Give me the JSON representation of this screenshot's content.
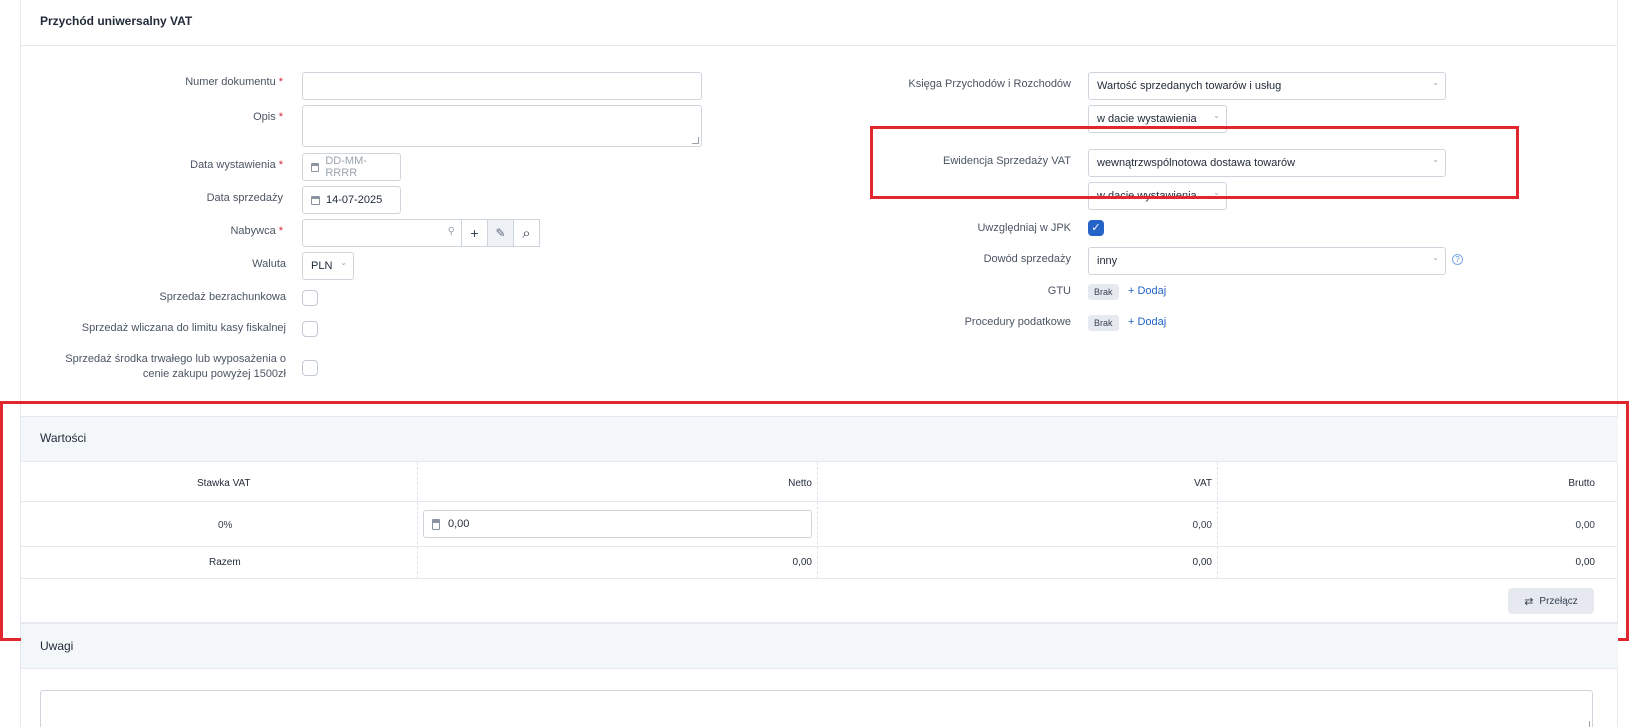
{
  "header": {
    "title": "Przychód uniwersalny VAT"
  },
  "left_form": {
    "numer_dokumentu": {
      "label": "Numer dokumentu",
      "required": "*",
      "value": ""
    },
    "opis": {
      "label": "Opis",
      "required": "*",
      "value": ""
    },
    "data_wystawienia": {
      "label": "Data wystawienia",
      "required": "*",
      "placeholder": "DD-MM-RRRR"
    },
    "data_sprzedazy": {
      "label": "Data sprzedaży",
      "value": "14-07-2025"
    },
    "nabywca": {
      "label": "Nabywca",
      "required": "*",
      "value": ""
    },
    "waluta": {
      "label": "Waluta",
      "value": "PLN"
    },
    "sprzedaz_bezrachunkowa": {
      "label": "Sprzedaż bezrachunkowa",
      "checked": false
    },
    "limit_kasy": {
      "label": "Sprzedaż wliczana do limitu kasy fiskalnej",
      "checked": false
    },
    "srodek_trwaly": {
      "label_line1": "Sprzedaż środka trwałego lub wyposażenia o",
      "label_line2": "cenie zakupu powyżej 1500zł",
      "checked": false
    }
  },
  "right_form": {
    "kpir": {
      "label": "Księga Przychodów i Rozchodów",
      "value": "Wartość sprzedanych towarów i usług",
      "date_mode": "w dacie wystawienia"
    },
    "ewidencja": {
      "label": "Ewidencja Sprzedaży VAT",
      "value": "wewnątrzwspólnotowa dostawa towarów",
      "date_mode": "w dacie wystawienia"
    },
    "jpk": {
      "label": "Uwzględniaj w JPK",
      "checked": true,
      "check_glyph": "✓"
    },
    "dowod": {
      "label": "Dowód sprzedaży",
      "value": "inny",
      "help": "?"
    },
    "gtu": {
      "label": "GTU",
      "badge": "Brak",
      "add": "+ Dodaj"
    },
    "procedury": {
      "label": "Procedury podatkowe",
      "badge": "Brak",
      "add": "+ Dodaj"
    }
  },
  "values_section": {
    "title": "Wartości",
    "columns": [
      "Stawka VAT",
      "Netto",
      "VAT",
      "Brutto"
    ],
    "row": {
      "stawka": "0%",
      "netto": "0,00",
      "vat": "0,00",
      "brutto": "0,00"
    },
    "total": {
      "label": "Razem",
      "netto": "0,00",
      "vat": "0,00",
      "brutto": "0,00"
    },
    "switch_label": "Przełącz",
    "switch_icon": "⇄"
  },
  "notes_section": {
    "title": "Uwagi"
  },
  "icons": {
    "plus": "+",
    "edit": "✎",
    "search": "⌕",
    "chevron": "⌄",
    "small_search": "⚲"
  },
  "colors": {
    "accent": "#2463c7",
    "highlight": "#e1262d",
    "required": "#d7263d"
  }
}
